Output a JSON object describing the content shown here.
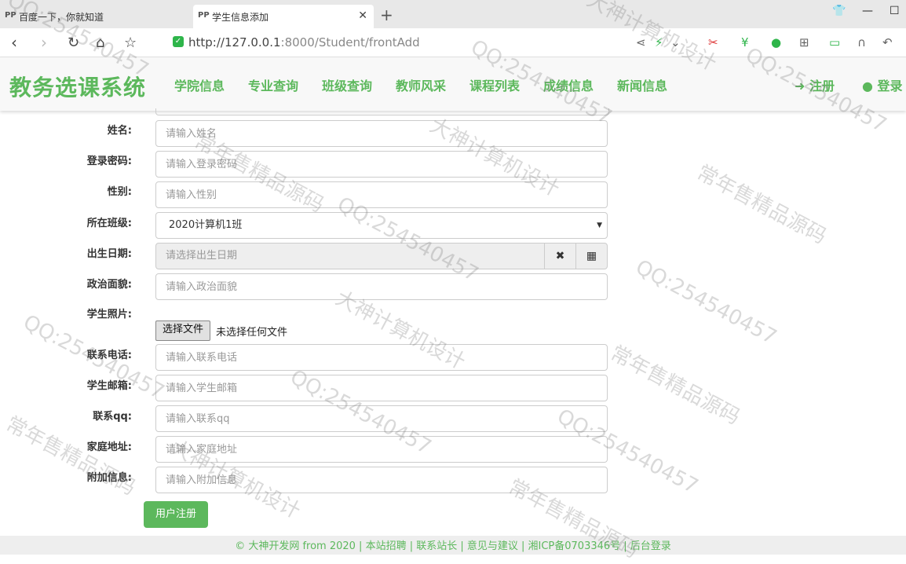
{
  "browser": {
    "tabs": [
      {
        "title": "百度一下，你就知道",
        "icon": "paw-icon"
      },
      {
        "title": "学生信息添加",
        "icon": "paw-icon",
        "active": true
      }
    ],
    "address": {
      "host": "http://127.0.0.1",
      "rest": ":8000/Student/frontAdd"
    }
  },
  "navbar": {
    "brand": "教务选课系统",
    "links": [
      "学院信息",
      "专业查询",
      "班级查询",
      "教师风采",
      "课程列表",
      "成绩信息",
      "新闻信息"
    ],
    "register": "注册",
    "login": "登录"
  },
  "form": {
    "name": {
      "label": "姓名:",
      "placeholder": "请输入姓名"
    },
    "password": {
      "label": "登录密码:",
      "placeholder": "请输入登录密码"
    },
    "gender": {
      "label": "性别:",
      "placeholder": "请输入性别"
    },
    "class": {
      "label": "所在班级:",
      "value": "2020计算机1班"
    },
    "birthday": {
      "label": "出生日期:",
      "placeholder": "请选择出生日期"
    },
    "politics": {
      "label": "政治面貌:",
      "placeholder": "请输入政治面貌"
    },
    "photo": {
      "label": "学生照片:",
      "button": "选择文件",
      "status": "未选择任何文件"
    },
    "phone": {
      "label": "联系电话:",
      "placeholder": "请输入联系电话"
    },
    "email": {
      "label": "学生邮箱:",
      "placeholder": "请输入学生邮箱"
    },
    "qq": {
      "label": "联系qq:",
      "placeholder": "请输入联系qq"
    },
    "address": {
      "label": "家庭地址:",
      "placeholder": "请输入家庭地址"
    },
    "memo": {
      "label": "附加信息:",
      "placeholder": "请输入附加信息"
    },
    "submit": "用户注册"
  },
  "footer": "© 大神开发网 from 2020 | 本站招聘 | 联系站长 | 意见与建议 | 湘ICP备0703346号 | 后台登录",
  "watermarks": [
    "QQ:254540457",
    "大神计算机设计",
    "常年售精品源码"
  ]
}
